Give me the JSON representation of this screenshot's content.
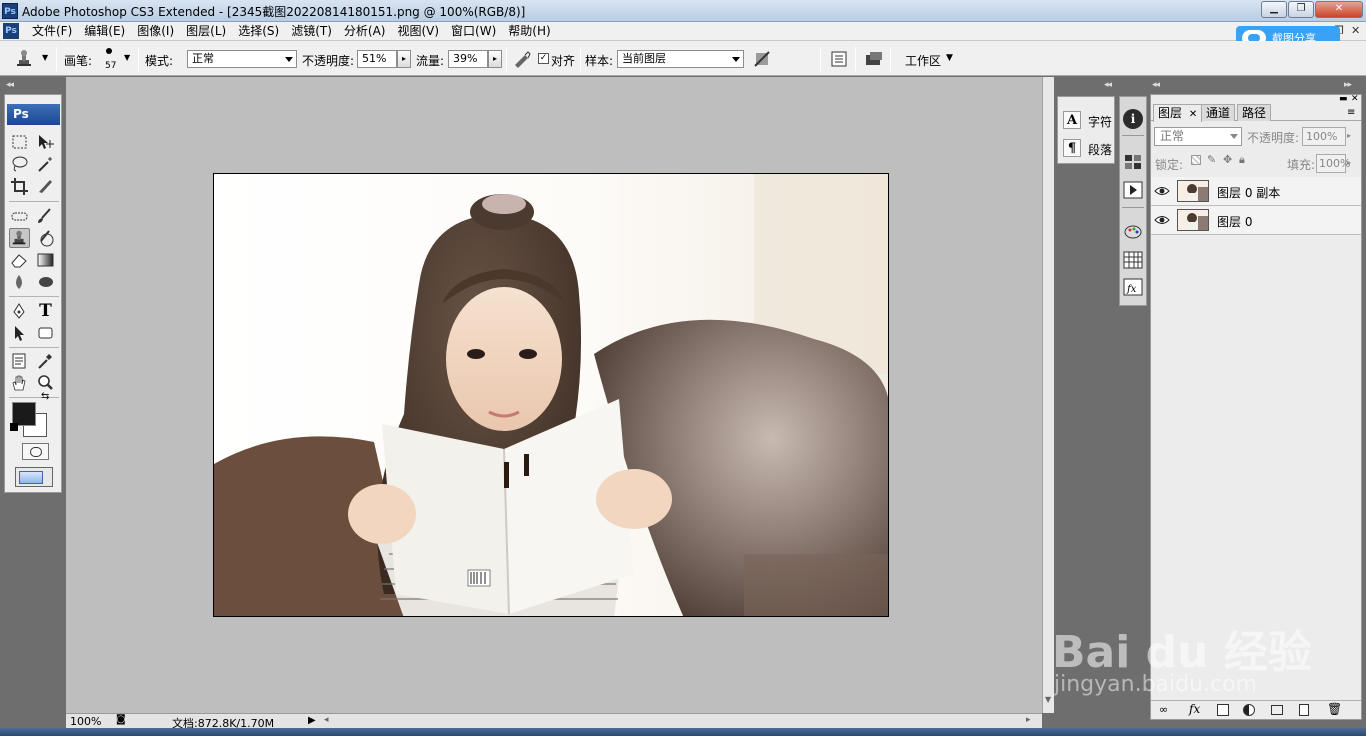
{
  "window": {
    "title": "Adobe Photoshop CS3 Extended - [2345截图20220814180151.png @ 100%(RGB/8)]",
    "app_badge": "Ps"
  },
  "menu": {
    "items": [
      "文件(F)",
      "编辑(E)",
      "图像(I)",
      "图层(L)",
      "选择(S)",
      "滤镜(T)",
      "分析(A)",
      "视图(V)",
      "窗口(W)",
      "帮助(H)"
    ]
  },
  "share_button": {
    "label": "截图分享"
  },
  "options": {
    "brush_label": "画笔:",
    "brush_size": "57",
    "mode_label": "模式:",
    "mode_value": "正常",
    "opacity_label": "不透明度:",
    "opacity_value": "51%",
    "flow_label": "流量:",
    "flow_value": "39%",
    "aligned_label": "对齐",
    "aligned_checked": true,
    "sample_label": "样本:",
    "sample_value": "当前图层",
    "workspace_label": "工作区"
  },
  "toolbox": {
    "header": "Ps"
  },
  "char_panel": {
    "items": [
      {
        "icon": "A",
        "label": "字符"
      },
      {
        "icon": "¶",
        "label": "段落"
      }
    ]
  },
  "layers_panel": {
    "tabs": [
      "图层",
      "通道",
      "路径"
    ],
    "active_tab": "图层",
    "blend_mode": "正常",
    "opacity_label": "不透明度:",
    "opacity_value": "100%",
    "lock_label": "锁定:",
    "fill_label": "填充:",
    "fill_value": "100%",
    "layers": [
      {
        "name": "图层 0 副本",
        "visible": true
      },
      {
        "name": "图层 0",
        "visible": true
      }
    ]
  },
  "status": {
    "zoom": "100%",
    "doc_info": "文档:872.8K/1.70M"
  },
  "watermark": {
    "brand": "Bai du 经验",
    "url": "jingyan.baidu.com"
  },
  "colors": {
    "workspace_bg": "#bebebe",
    "panel_bg": "#ececec",
    "accent": "#1c4792",
    "foreground_swatch": "#1a1a1a",
    "background_swatch": "#ffffff"
  }
}
